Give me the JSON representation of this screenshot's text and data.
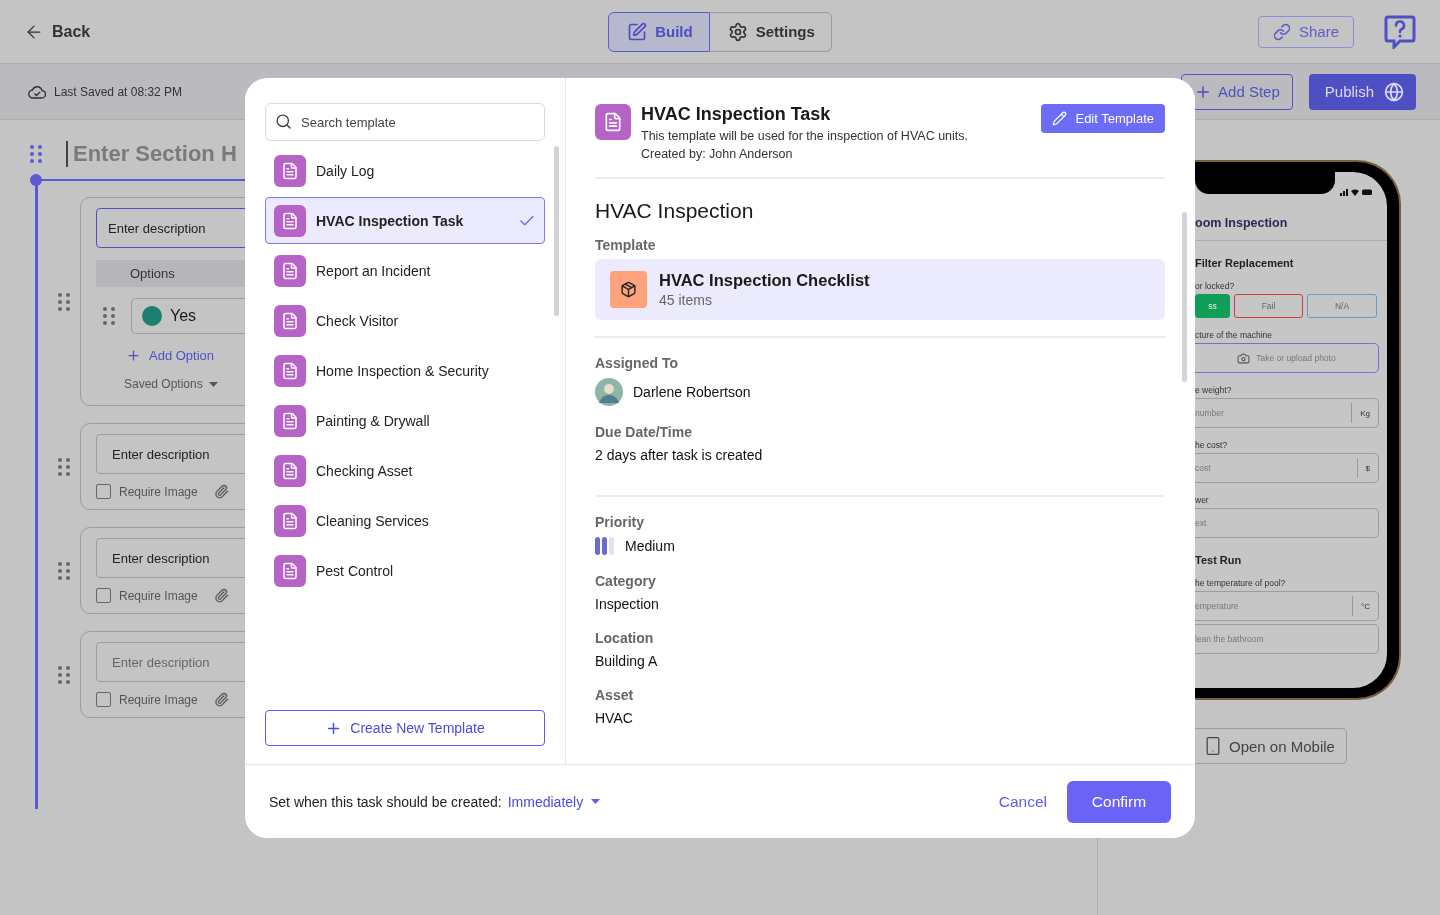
{
  "top_bar": {
    "back": "Back",
    "tabs": [
      {
        "label": "Build",
        "selected": true
      },
      {
        "label": "Settings",
        "selected": false
      }
    ],
    "share": "Share"
  },
  "sub_bar": {
    "last_saved": "Last Saved at 08:32 PM",
    "add_step": "Add Step",
    "publish": "Publish"
  },
  "builder": {
    "section_heading": "Enter Section H",
    "cards": [
      {
        "kind": "options",
        "description": {
          "value": "Enter description",
          "focused": true
        },
        "options_header": "Options",
        "options": [
          {
            "label": "Yes",
            "color": "#1d7f70"
          }
        ],
        "add_option": "Add Option",
        "saved_options": "Saved Options"
      },
      {
        "kind": "image",
        "description": {
          "value": "Enter description",
          "focused": false
        },
        "require_image": {
          "label": "Require Image",
          "checked": false
        }
      },
      {
        "kind": "image",
        "description": {
          "value": "Enter description",
          "focused": false
        },
        "require_image": {
          "label": "Require Image",
          "checked": false
        }
      },
      {
        "kind": "image",
        "description": {
          "placeholder": "Enter description",
          "focused": false
        },
        "require_image": {
          "label": "Require Image",
          "checked": false
        }
      }
    ]
  },
  "preview": {
    "title": "oom Inspection",
    "items": [
      {
        "kind": "section",
        "text": "Filter Replacement"
      },
      {
        "kind": "label",
        "text": "or locked?"
      },
      {
        "kind": "choices",
        "choices": [
          {
            "label": "ss",
            "selected": true,
            "color": "#0f9d58"
          },
          {
            "label": "Fail",
            "selected": false,
            "color": "#d23c3c"
          },
          {
            "label": "N/A",
            "selected": false,
            "color": "#5a9fd0"
          }
        ]
      },
      {
        "kind": "label",
        "text": "cture of the machine"
      },
      {
        "kind": "photo",
        "placeholder": "Take or upload photo"
      },
      {
        "kind": "label",
        "text": "e weight?"
      },
      {
        "kind": "unit",
        "placeholder": "number",
        "unit": "Kg"
      },
      {
        "kind": "label",
        "text": "he cost?"
      },
      {
        "kind": "unit",
        "placeholder": "cost",
        "unit": "$"
      },
      {
        "kind": "label",
        "text": "wer"
      },
      {
        "kind": "text",
        "placeholder": "ext"
      },
      {
        "kind": "section",
        "text": "Test Run"
      },
      {
        "kind": "label",
        "text": "he temperature of pool?"
      },
      {
        "kind": "unit",
        "placeholder": "emperature",
        "unit": "°C"
      },
      {
        "kind": "text",
        "placeholder": "lean the bathroom"
      }
    ],
    "open_mobile": "Open on Mobile"
  },
  "modal": {
    "search": {
      "placeholder": "Search template"
    },
    "templates": [
      {
        "name": "Daily Log",
        "selected": false
      },
      {
        "name": "HVAC Inspection Task",
        "selected": true
      },
      {
        "name": "Report an Incident",
        "selected": false
      },
      {
        "name": "Check Visitor",
        "selected": false
      },
      {
        "name": "Home Inspection & Security",
        "selected": false
      },
      {
        "name": "Painting & Drywall",
        "selected": false
      },
      {
        "name": "Checking Asset",
        "selected": false
      },
      {
        "name": "Cleaning Services",
        "selected": false
      },
      {
        "name": "Pest Control",
        "selected": false
      }
    ],
    "create_button": "Create New Template",
    "detail": {
      "title": "HVAC Inspection Task",
      "description": "This template will be used for the inspection of HVAC units.",
      "created_by": "Created by: John Anderson",
      "edit_button": "Edit Template",
      "heading": "HVAC Inspection",
      "template_label": "Template",
      "template": {
        "name": "HVAC Inspection Checklist",
        "count": "45 items"
      },
      "groups": [
        [
          {
            "kind": "person",
            "label": "Assigned To",
            "value": "Darlene Robertson"
          },
          {
            "kind": "text",
            "label": "Due Date/Time",
            "value": "2 days after task is created"
          }
        ],
        [
          {
            "kind": "priority",
            "label": "Priority",
            "value": "Medium",
            "level": 0.67
          },
          {
            "kind": "text",
            "label": "Category",
            "value": "Inspection"
          },
          {
            "kind": "text",
            "label": "Location",
            "value": "Building A"
          },
          {
            "kind": "text",
            "label": "Asset",
            "value": "HVAC"
          }
        ]
      ]
    },
    "footer": {
      "prompt": "Set when this task should be created:",
      "timing": "Immediately",
      "cancel": "Cancel",
      "confirm": "Confirm"
    }
  }
}
